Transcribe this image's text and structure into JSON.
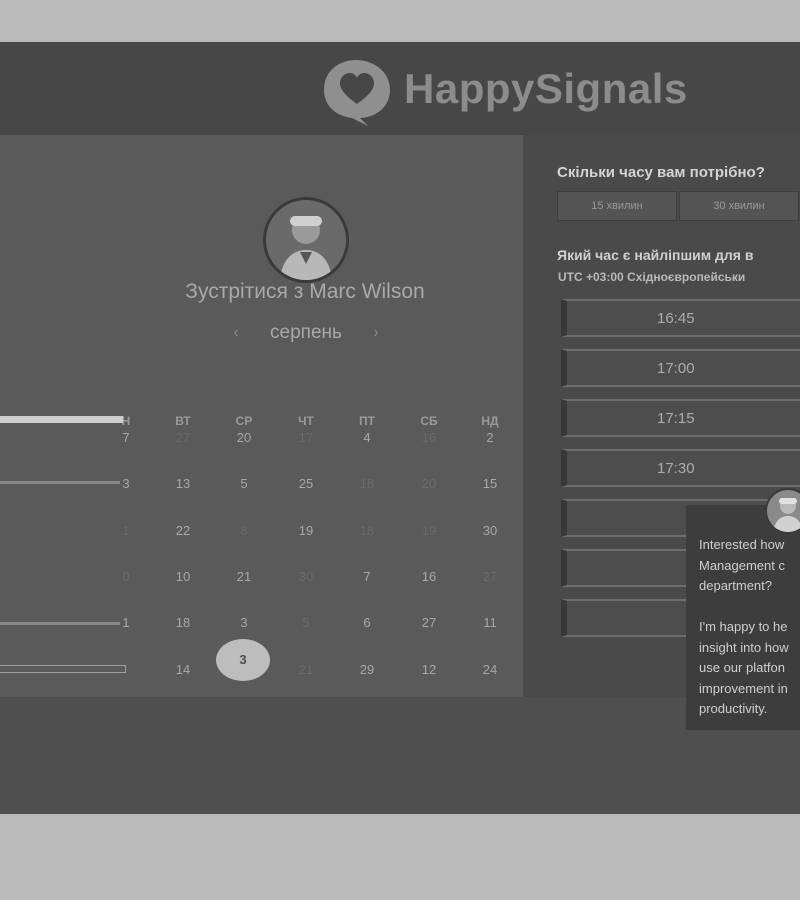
{
  "brand": {
    "name": "HappySignals"
  },
  "meeting": {
    "title": "Зустрітися з Marc Wilson"
  },
  "calendar": {
    "month": "серпень",
    "weekdays": [
      "Н",
      "ВТ",
      "СР",
      "ЧТ",
      "ПТ",
      "СБ",
      "НД"
    ],
    "rows": [
      [
        "7",
        "27",
        "20",
        "17",
        "4",
        "16",
        "2"
      ],
      [
        "3",
        "13",
        "5",
        "25",
        "18",
        "20",
        "15"
      ],
      [
        "1",
        "22",
        "8",
        "19",
        "18",
        "19",
        "30"
      ],
      [
        "0",
        "10",
        "21",
        "30",
        "7",
        "16",
        "27"
      ],
      [
        "1",
        "18",
        "3",
        "5",
        "6",
        "27",
        "11"
      ],
      [
        "",
        "14",
        "3",
        "21",
        "29",
        "12",
        "24"
      ]
    ],
    "selected": "3"
  },
  "duration": {
    "question": "Скільки часу вам потрібно?",
    "options": [
      "15 хвилин",
      "30 хвилин"
    ]
  },
  "time": {
    "question": "Який час є найліпшим для в",
    "timezone": "UTC +03:00 Східноєвропейськи",
    "slots": [
      "16:45",
      "17:00",
      "17:15",
      "17:30",
      "",
      "",
      ""
    ]
  },
  "chat": {
    "message": "Interested how\nManagement c\ndepartment?\n\nI'm happy to he\ninsight into how\nuse our platfon\nimprovement in\nproductivity."
  }
}
